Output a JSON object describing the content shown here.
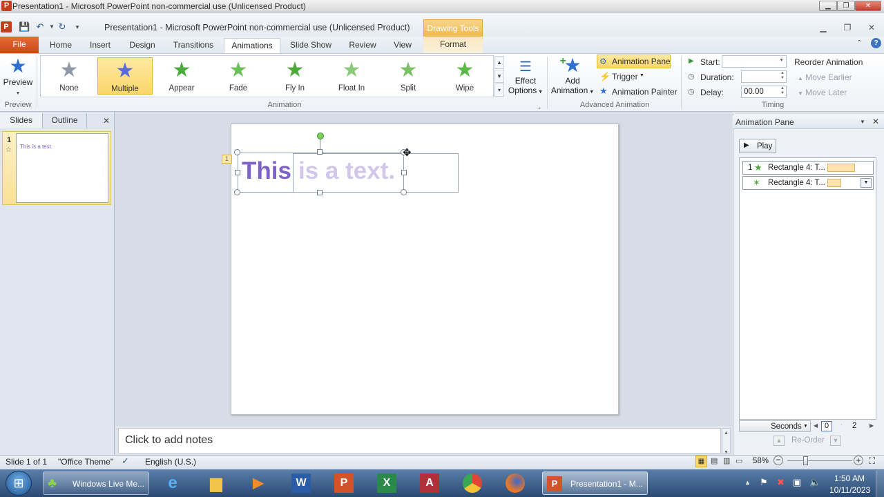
{
  "os_title": "Presentation1 - Microsoft PowerPoint non-commercial use (Unlicensed Product)",
  "app_title": "Presentation1  -  Microsoft PowerPoint non-commercial use (Unlicensed Product)",
  "contextual_tab": "Drawing Tools",
  "tabs": {
    "file": "File",
    "home": "Home",
    "insert": "Insert",
    "design": "Design",
    "transitions": "Transitions",
    "animations": "Animations",
    "slideshow": "Slide Show",
    "review": "Review",
    "view": "View",
    "format": "Format"
  },
  "ribbon": {
    "preview": {
      "label": "Preview",
      "group": "Preview"
    },
    "animation_group": "Animation",
    "gallery": [
      {
        "label": "None",
        "color": "#8e98a6"
      },
      {
        "label": "Multiple",
        "color": "#5a6ad8"
      },
      {
        "label": "Appear",
        "color": "#4caa3c"
      },
      {
        "label": "Fade",
        "color": "#6cc05a"
      },
      {
        "label": "Fly In",
        "color": "#4caa3c"
      },
      {
        "label": "Float In",
        "color": "#8cc87a"
      },
      {
        "label": "Split",
        "color": "#7cc068"
      },
      {
        "label": "Wipe",
        "color": "#5cb848"
      }
    ],
    "effect_options": {
      "line1": "Effect",
      "line2": "Options"
    },
    "add_animation": {
      "line1": "Add",
      "line2": "Animation"
    },
    "animation_pane": "Animation Pane",
    "trigger": "Trigger",
    "animation_painter": "Animation Painter",
    "advanced_group": "Advanced Animation",
    "timing": {
      "start_label": "Start:",
      "start_value": "",
      "duration_label": "Duration:",
      "duration_value": "",
      "delay_label": "Delay:",
      "delay_value": "00.00",
      "group": "Timing",
      "reorder": "Reorder Animation",
      "move_earlier": "Move Earlier",
      "move_later": "Move Later"
    }
  },
  "left_pane": {
    "slides_tab": "Slides",
    "outline_tab": "Outline",
    "slide_number": "1",
    "thumb_text": "This is a text."
  },
  "slide": {
    "text_this": "This",
    "text_rest": "is a text.",
    "anim_tag": "1",
    "text_color": "#7b61c8"
  },
  "notes_placeholder": "Click to add notes",
  "anim_pane": {
    "title": "Animation Pane",
    "play": "Play",
    "items": [
      {
        "number": "1",
        "label": "Rectangle 4: T..."
      },
      {
        "number": "",
        "label": "Rectangle 4: T..."
      }
    ],
    "seconds": "Seconds",
    "scale_start": "0",
    "scale_mid": "2",
    "reorder": "Re-Order"
  },
  "status": {
    "slide": "Slide 1 of 1",
    "theme": "\"Office Theme\"",
    "language": "English (U.S.)",
    "zoom": "58%",
    "zoom_fraction": 0.58
  },
  "taskbar": {
    "live_messenger": "Windows Live Me...",
    "presentation": "Presentation1 - M...",
    "time": "1:50 AM",
    "date": "10/11/2023"
  }
}
